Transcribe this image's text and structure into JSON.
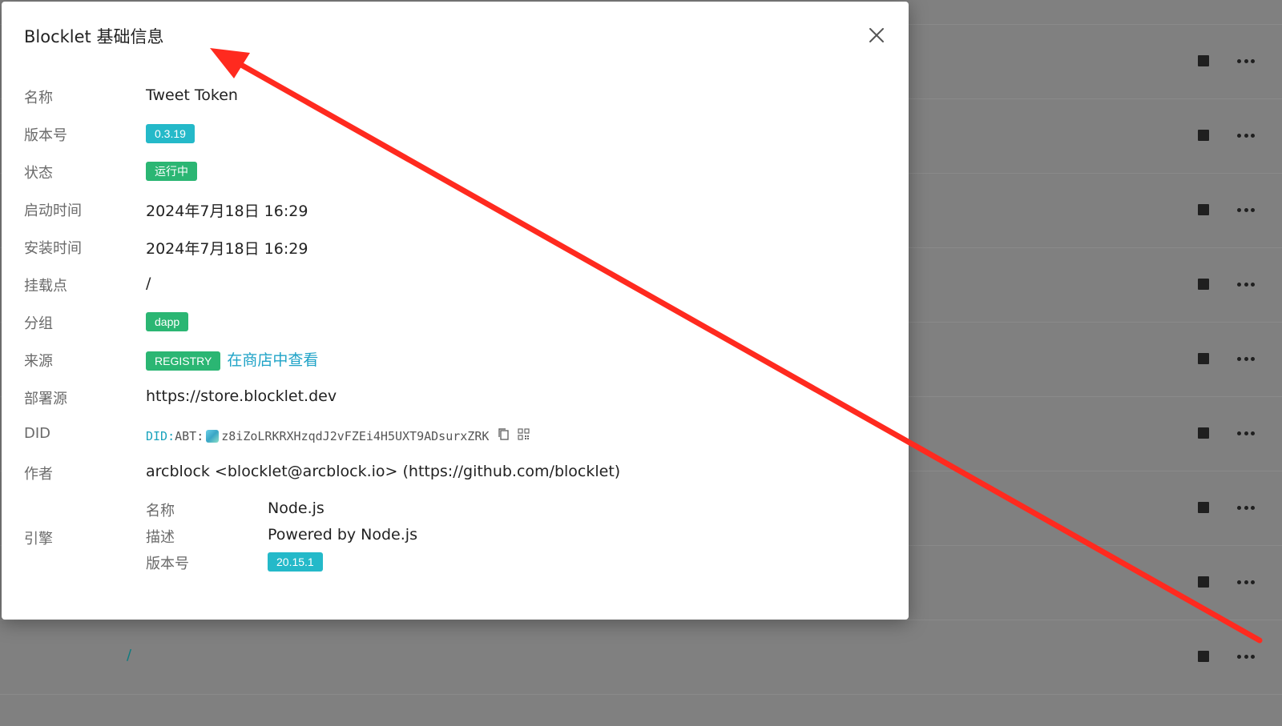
{
  "modal": {
    "title": "Blocklet 基础信息",
    "fields": {
      "name": {
        "label": "名称",
        "value": "Tweet Token"
      },
      "version": {
        "label": "版本号",
        "value": "0.3.19"
      },
      "status": {
        "label": "状态",
        "value": "运行中"
      },
      "started_at": {
        "label": "启动时间",
        "value": "2024年7月18日 16:29"
      },
      "installed_at": {
        "label": "安装时间",
        "value": "2024年7月18日 16:29"
      },
      "mount_point": {
        "label": "挂载点",
        "value": "/"
      },
      "group": {
        "label": "分组",
        "value": "dapp"
      },
      "source": {
        "label": "来源",
        "badge": "REGISTRY",
        "link": "在商店中查看"
      },
      "deploy_source": {
        "label": "部署源",
        "value": "https://store.blocklet.dev"
      },
      "did": {
        "label": "DID",
        "prefix": "DID:",
        "type": "ABT:",
        "value": "z8iZoLRKRXHzqdJ2vFZEi4H5UXT9ADsurxZRK"
      },
      "author": {
        "label": "作者",
        "value": "arcblock <blocklet@arcblock.io> (https://github.com/blocklet)"
      },
      "engine": {
        "label": "引擎",
        "name": {
          "label": "名称",
          "value": "Node.js"
        },
        "description": {
          "label": "描述",
          "value": "Powered by Node.js"
        },
        "version": {
          "label": "版本号",
          "value": "20.15.1"
        }
      }
    }
  },
  "background": {
    "mount_point": "/"
  },
  "icons": {
    "close": "close-icon",
    "copy": "copy-icon",
    "qrcode": "qrcode-icon",
    "stop": "stop-icon",
    "more": "more-icon"
  },
  "colors": {
    "overlay": "#808080",
    "badge_cyan": "#24b9c9",
    "badge_green": "#2bb673",
    "link": "#1fa3c7",
    "annotation_arrow": "#ff2a1f"
  }
}
